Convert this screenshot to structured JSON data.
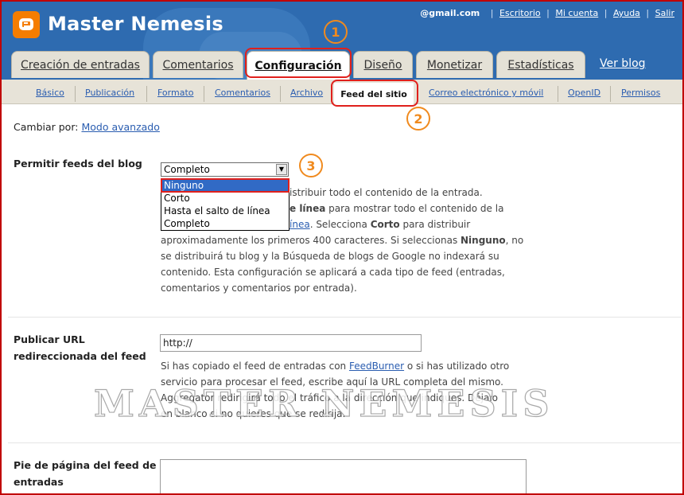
{
  "header": {
    "title": "Master Nemesis",
    "email": "@gmail.com",
    "links": [
      "Escritorio",
      "Mi cuenta",
      "Ayuda",
      "Salir"
    ]
  },
  "tabs": [
    "Creación de entradas",
    "Comentarios",
    "Configuración",
    "Diseño",
    "Monetizar",
    "Estadísticas"
  ],
  "view_blog": "Ver blog",
  "subtabs": [
    "Básico",
    "Publicación",
    "Formato",
    "Comentarios",
    "Archivo",
    "Feed del sitio",
    "Correo electrónico y móvil",
    "OpenID",
    "Permisos"
  ],
  "annotations": [
    "1",
    "2",
    "3"
  ],
  "mode": {
    "label": "Cambiar por:",
    "link": "Modo avanzado"
  },
  "feeds": {
    "label": "Permitir feeds del blog",
    "selected": "Completo",
    "options": [
      "Ninguno",
      "Corto",
      "Hasta el salto de línea",
      "Completo"
    ],
    "desc_line1": "istribuir todo el contenido de la entrada.",
    "desc_line2_bold": "e línea",
    "desc_line2_rest": " para mostrar todo el contenido de la",
    "desc_line3_link": "ínea",
    "desc_line3_rest1": ". Selecciona ",
    "desc_line3_bold": "Corto",
    "desc_line3_rest2": " para distribuir",
    "desc_line4_a": "aproximadamente los primeros 400 caracteres. Si seleccionas ",
    "desc_line4_bold": "Ninguno",
    "desc_line4_b": ", no",
    "desc_line5": "se distribuirá tu blog y la Búsqueda de blogs de Google no indexará su",
    "desc_line6": "contenido. Esta configuración se aplicará a cada tipo de feed (entradas,",
    "desc_line7": "comentarios y comentarios por entrada)."
  },
  "redirect": {
    "label_line1": "Publicar URL",
    "label_line2": "redireccionada del feed",
    "value": "http://",
    "desc_line1_a": "Si has copiado el feed de entradas con ",
    "desc_line1_link": "FeedBurner",
    "desc_line1_b": " o si has utilizado otro",
    "desc_line2": "servicio para procesar el feed, escribe aquí la URL completa del mismo.",
    "desc_line3": "Aggregator redirigirá todo el tráfico a la dirección que indiques. Déjalo",
    "desc_line4": "en blanco si no quieres que se redirija."
  },
  "footer_feed": {
    "label_line1": "Pie de página del feed de",
    "label_line2": "entradas"
  },
  "watermark": "MASTER NEMESIS"
}
